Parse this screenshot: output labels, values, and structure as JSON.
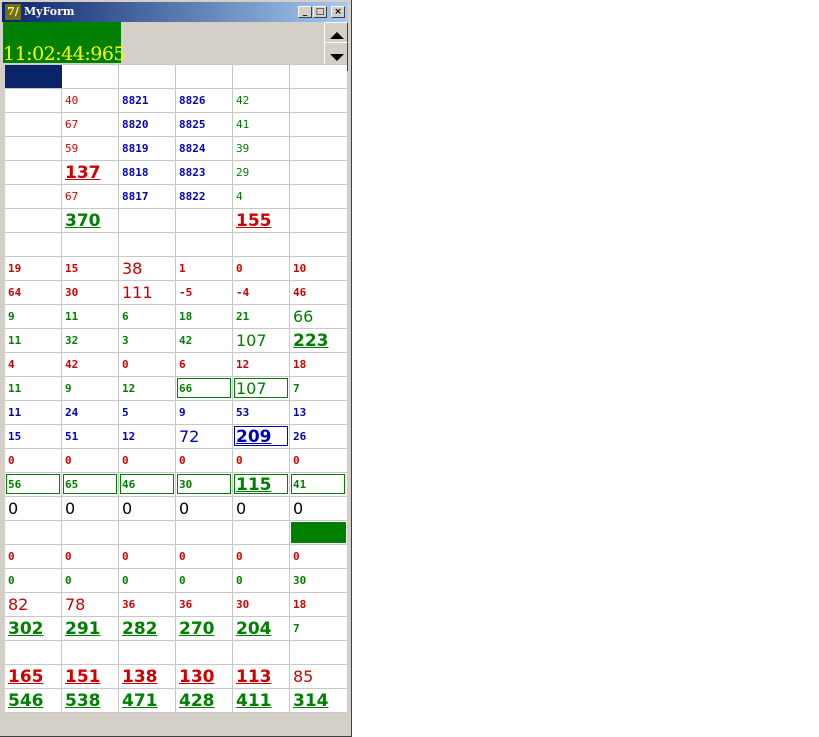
{
  "window": {
    "title": "MyForm",
    "app_icon": "7/"
  },
  "clock": "11:02:44:965",
  "colors": {
    "red": "#d00000",
    "green": "#008000",
    "blue": "#0000c0",
    "black": "#000000",
    "header": "#0a246a"
  },
  "rows": [
    [],
    [
      [
        "",
        "s",
        ""
      ],
      [
        "40",
        "sn",
        "red"
      ],
      [
        "8821",
        "s",
        "blue"
      ],
      [
        "8826",
        "s",
        "blue"
      ],
      [
        "42",
        "sn",
        "green"
      ],
      [
        "",
        "s",
        ""
      ]
    ],
    [
      [
        "",
        "s",
        ""
      ],
      [
        "67",
        "sn",
        "red"
      ],
      [
        "8820",
        "s",
        "blue"
      ],
      [
        "8825",
        "s",
        "blue"
      ],
      [
        "41",
        "sn",
        "green"
      ],
      [
        "",
        "s",
        ""
      ]
    ],
    [
      [
        "",
        "s",
        ""
      ],
      [
        "59",
        "sn",
        "red"
      ],
      [
        "8819",
        "s",
        "blue"
      ],
      [
        "8824",
        "s",
        "blue"
      ],
      [
        "39",
        "sn",
        "green"
      ],
      [
        "",
        "s",
        ""
      ]
    ],
    [
      [
        "",
        "s",
        ""
      ],
      [
        "137",
        "b",
        "red"
      ],
      [
        "8818",
        "s",
        "blue"
      ],
      [
        "8823",
        "s",
        "blue"
      ],
      [
        "29",
        "sn",
        "green"
      ],
      [
        "",
        "s",
        ""
      ]
    ],
    [
      [
        "",
        "s",
        ""
      ],
      [
        "67",
        "sn",
        "red"
      ],
      [
        "8817",
        "s",
        "blue"
      ],
      [
        "8822",
        "s",
        "blue"
      ],
      [
        "4",
        "sn",
        "green"
      ],
      [
        "",
        "s",
        ""
      ]
    ],
    [
      [
        "",
        "s",
        ""
      ],
      [
        "370",
        "b",
        "green"
      ],
      [
        "",
        "s",
        ""
      ],
      [
        "",
        "s",
        ""
      ],
      [
        "155",
        "b",
        "red"
      ],
      [
        "",
        "s",
        ""
      ]
    ],
    [],
    [
      [
        "19",
        "s",
        "red"
      ],
      [
        "15",
        "s",
        "red"
      ],
      [
        "38",
        "m",
        "red"
      ],
      [
        "1",
        "s",
        "red"
      ],
      [
        "0",
        "s",
        "red"
      ],
      [
        "10",
        "s",
        "red"
      ]
    ],
    [
      [
        "64",
        "s",
        "red"
      ],
      [
        "30",
        "s",
        "red"
      ],
      [
        "111",
        "m",
        "red"
      ],
      [
        "-5",
        "s",
        "red"
      ],
      [
        "-4",
        "s",
        "red"
      ],
      [
        "46",
        "s",
        "red"
      ]
    ],
    [
      [
        "9",
        "s",
        "green"
      ],
      [
        "11",
        "s",
        "green"
      ],
      [
        "6",
        "s",
        "green"
      ],
      [
        "18",
        "s",
        "green"
      ],
      [
        "21",
        "s",
        "green"
      ],
      [
        "66",
        "m",
        "green"
      ]
    ],
    [
      [
        "11",
        "s",
        "green"
      ],
      [
        "32",
        "s",
        "green"
      ],
      [
        "3",
        "s",
        "green"
      ],
      [
        "42",
        "s",
        "green"
      ],
      [
        "107",
        "m",
        "green"
      ],
      [
        "223",
        "b",
        "green"
      ]
    ],
    [
      [
        "4",
        "s",
        "red"
      ],
      [
        "42",
        "s",
        "red"
      ],
      [
        "0",
        "s",
        "red"
      ],
      [
        "6",
        "s",
        "red"
      ],
      [
        "12",
        "s",
        "red"
      ],
      [
        "18",
        "s",
        "red"
      ]
    ],
    [
      [
        "11",
        "s",
        "green"
      ],
      [
        "9",
        "s",
        "green"
      ],
      [
        "12",
        "s",
        "green"
      ],
      [
        "66",
        "s",
        "green",
        "box"
      ],
      [
        "107",
        "m",
        "green",
        "box"
      ],
      [
        "7",
        "s",
        "green"
      ]
    ],
    [
      [
        "11",
        "s",
        "blue"
      ],
      [
        "24",
        "s",
        "blue"
      ],
      [
        "5",
        "s",
        "blue"
      ],
      [
        "9",
        "s",
        "blue"
      ],
      [
        "53",
        "s",
        "blue"
      ],
      [
        "13",
        "s",
        "blue"
      ]
    ],
    [
      [
        "15",
        "s",
        "blue"
      ],
      [
        "51",
        "s",
        "blue"
      ],
      [
        "12",
        "s",
        "blue"
      ],
      [
        "72",
        "m",
        "blue"
      ],
      [
        "209",
        "b",
        "blue",
        "box"
      ],
      [
        "26",
        "s",
        "blue"
      ]
    ],
    [
      [
        "0",
        "s",
        "red"
      ],
      [
        "0",
        "s",
        "red"
      ],
      [
        "0",
        "s",
        "red"
      ],
      [
        "0",
        "s",
        "red"
      ],
      [
        "0",
        "s",
        "red"
      ],
      [
        "0",
        "s",
        "red"
      ]
    ],
    [
      [
        "56",
        "s",
        "green",
        "box"
      ],
      [
        "65",
        "s",
        "green",
        "box"
      ],
      [
        "46",
        "s",
        "green",
        "box"
      ],
      [
        "30",
        "s",
        "green",
        "box"
      ],
      [
        "115",
        "b",
        "green",
        "box"
      ],
      [
        "41",
        "s",
        "green",
        "box"
      ]
    ],
    [
      [
        "0",
        "m",
        "black"
      ],
      [
        "0",
        "m",
        "black"
      ],
      [
        "0",
        "m",
        "black"
      ],
      [
        "0",
        "m",
        "black"
      ],
      [
        "0",
        "m",
        "black"
      ],
      [
        "0",
        "m",
        "black"
      ]
    ],
    [
      [
        "",
        "s",
        ""
      ],
      [
        "",
        "s",
        ""
      ],
      [
        "",
        "s",
        ""
      ],
      [
        "",
        "s",
        ""
      ],
      [
        "",
        "s",
        ""
      ],
      [
        "",
        "s",
        "",
        "fill"
      ]
    ],
    [
      [
        "0",
        "s",
        "red"
      ],
      [
        "0",
        "s",
        "red"
      ],
      [
        "0",
        "s",
        "red"
      ],
      [
        "0",
        "s",
        "red"
      ],
      [
        "0",
        "s",
        "red"
      ],
      [
        "0",
        "s",
        "red"
      ]
    ],
    [
      [
        "0",
        "s",
        "green"
      ],
      [
        "0",
        "s",
        "green"
      ],
      [
        "0",
        "s",
        "green"
      ],
      [
        "0",
        "s",
        "green"
      ],
      [
        "0",
        "s",
        "green"
      ],
      [
        "30",
        "s",
        "green"
      ]
    ],
    [
      [
        "82",
        "m",
        "red"
      ],
      [
        "78",
        "m",
        "red"
      ],
      [
        "36",
        "s",
        "red"
      ],
      [
        "36",
        "s",
        "red"
      ],
      [
        "30",
        "s",
        "red"
      ],
      [
        "18",
        "s",
        "red"
      ]
    ],
    [
      [
        "302",
        "b",
        "green"
      ],
      [
        "291",
        "b",
        "green"
      ],
      [
        "282",
        "b",
        "green"
      ],
      [
        "270",
        "b",
        "green"
      ],
      [
        "204",
        "b",
        "green"
      ],
      [
        "7",
        "s",
        "green"
      ]
    ],
    [],
    [
      [
        "165",
        "b",
        "red"
      ],
      [
        "151",
        "b",
        "red"
      ],
      [
        "138",
        "b",
        "red"
      ],
      [
        "130",
        "b",
        "red"
      ],
      [
        "113",
        "b",
        "red"
      ],
      [
        "85",
        "m",
        "red"
      ]
    ],
    [
      [
        "546",
        "b",
        "green"
      ],
      [
        "538",
        "b",
        "green"
      ],
      [
        "471",
        "b",
        "green"
      ],
      [
        "428",
        "b",
        "green"
      ],
      [
        "411",
        "b",
        "green"
      ],
      [
        "314",
        "b",
        "green"
      ]
    ]
  ]
}
